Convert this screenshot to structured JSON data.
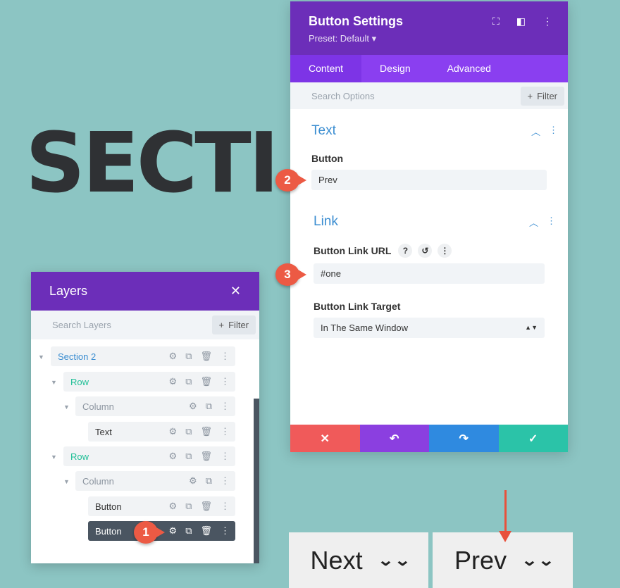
{
  "hero": {
    "text": "SECTI"
  },
  "bottom_buttons": [
    {
      "label": "Next",
      "chevron": "»"
    },
    {
      "label": "Prev",
      "chevron": "»"
    }
  ],
  "settings": {
    "title": "Button Settings",
    "preset": "Preset: Default ▾",
    "header_icons": [
      "fullscreen-icon",
      "split-view-icon",
      "more-icon"
    ],
    "tabs": [
      {
        "label": "Content",
        "active": true
      },
      {
        "label": "Design",
        "active": false
      },
      {
        "label": "Advanced",
        "active": false
      }
    ],
    "search_placeholder": "Search Options",
    "filter_label": "Filter",
    "text_section": {
      "title": "Text",
      "button_label": "Button",
      "button_value": "Prev"
    },
    "link_section": {
      "title": "Link",
      "url_label": "Button Link URL",
      "url_value": "#one",
      "target_label": "Button Link Target",
      "target_value": "In The Same Window"
    },
    "footer_colors": [
      "#f05a5a",
      "#8b3fe0",
      "#2f8ae0",
      "#2bc3a8"
    ]
  },
  "layers": {
    "title": "Layers",
    "search_placeholder": "Search Layers",
    "filter_label": "Filter",
    "rows": [
      {
        "label": "Section 2",
        "color": "#3a8dd1"
      },
      {
        "label": "Row",
        "color": "#1fbf96"
      },
      {
        "label": "Column",
        "color": "#8c95a0"
      },
      {
        "label": "Text",
        "color": "#333333"
      },
      {
        "label": "Row",
        "color": "#1fbf96"
      },
      {
        "label": "Column",
        "color": "#8c95a0"
      },
      {
        "label": "Button",
        "color": "#333333"
      },
      {
        "label": "Button",
        "color": "#ffffff",
        "selected": true
      }
    ]
  },
  "callouts": [
    "1",
    "2",
    "3"
  ]
}
